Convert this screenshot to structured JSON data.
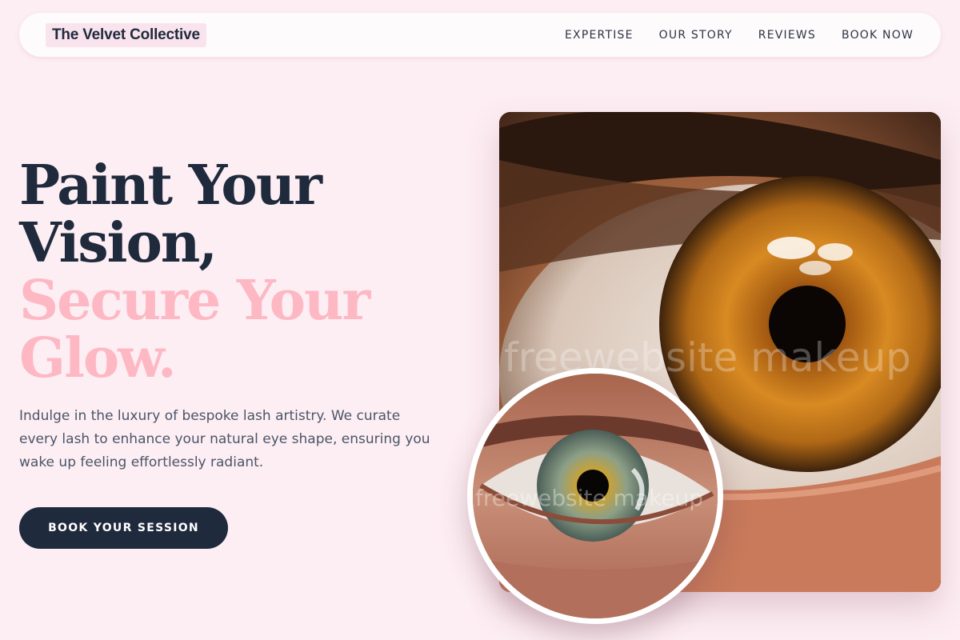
{
  "brand": {
    "name": "The Velvet Collective"
  },
  "nav": {
    "links": [
      "EXPERTISE",
      "OUR STORY",
      "REVIEWS",
      "BOOK NOW"
    ]
  },
  "hero": {
    "title_line1": "Paint Your",
    "title_line2": "Vision,",
    "title_line3": "Secure Your",
    "title_line4": "Glow.",
    "description": "Indulge in the luxury of bespoke lash artistry. We curate every lash to enhance your natural eye shape, ensuring you wake up feeling effortlessly radiant.",
    "cta_label": "BOOK YOUR SESSION"
  },
  "images": {
    "main_watermark": "freewebsite makeup",
    "inset_watermark": "freewebsite makeup"
  },
  "colors": {
    "background": "#fdeef3",
    "navy": "#1f2a3d",
    "pink_accent": "#fdb8c4",
    "brand_highlight": "#f9e3ec"
  }
}
